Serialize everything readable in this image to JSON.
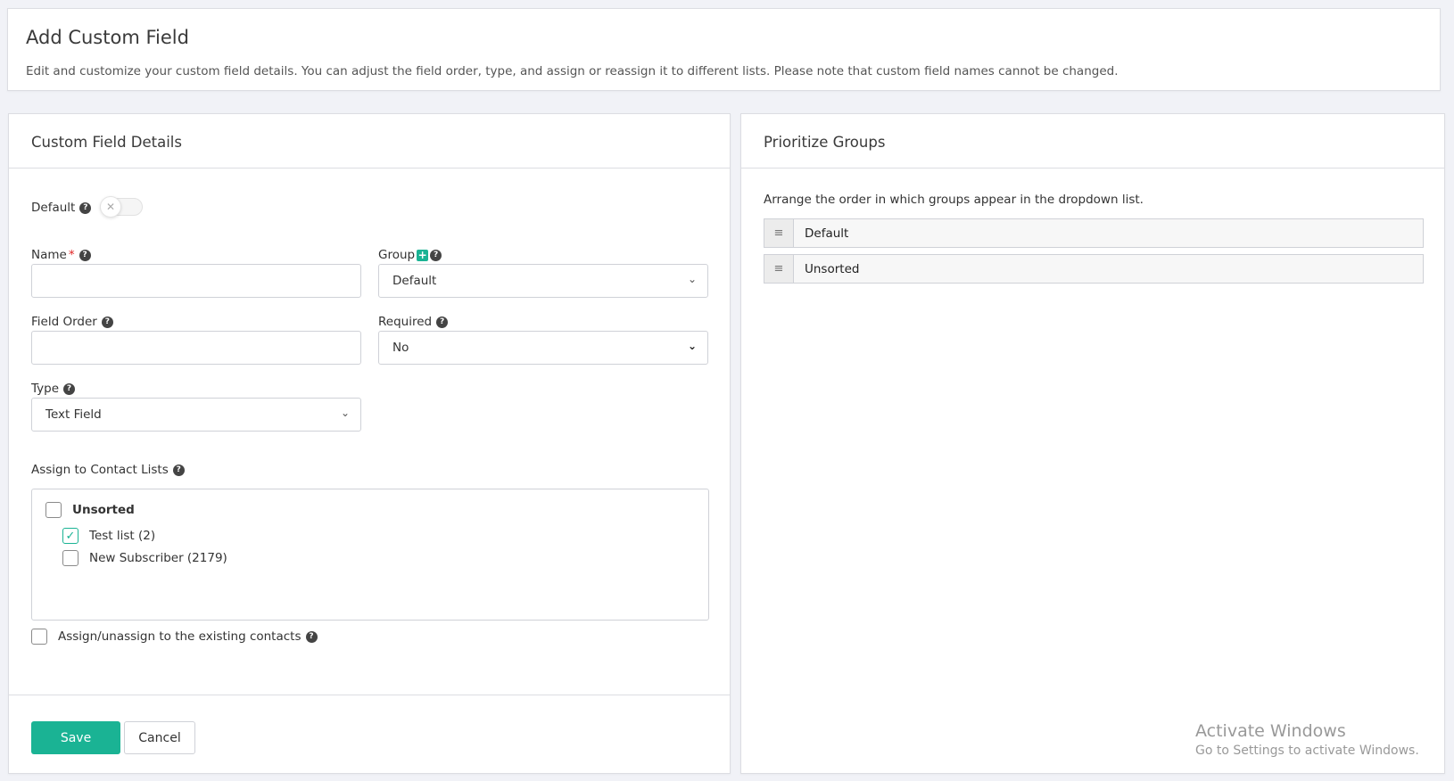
{
  "header": {
    "title": "Add Custom Field",
    "description": "Edit and customize your custom field details. You can adjust the field order, type, and assign or reassign it to different lists. Please note that custom field names cannot be changed."
  },
  "details": {
    "title": "Custom Field Details",
    "default_label": "Default",
    "default_on": false,
    "name_label": "Name",
    "name_required_mark": "*",
    "name_value": "",
    "group_label": "Group",
    "group_value": "Default",
    "field_order_label": "Field Order",
    "field_order_value": "",
    "required_label": "Required",
    "required_value": "No",
    "type_label": "Type",
    "type_value": "Text Field",
    "assign_lists_label": "Assign to Contact Lists",
    "list_group": {
      "label": "Unsorted",
      "checked": false
    },
    "lists": [
      {
        "label": "Test list (2)",
        "checked": true
      },
      {
        "label": "New Subscriber (2179)",
        "checked": false
      }
    ],
    "assign_existing_label": "Assign/unassign to the existing contacts",
    "save_label": "Save",
    "cancel_label": "Cancel"
  },
  "groups": {
    "title": "Prioritize Groups",
    "description": "Arrange the order in which groups appear in the dropdown list.",
    "items": [
      {
        "name": "Default"
      },
      {
        "name": "Unsorted"
      }
    ]
  },
  "watermark": {
    "line1": "Activate Windows",
    "line2": "Go to Settings to activate Windows."
  },
  "colors": {
    "accent": "#1ab394",
    "background": "#f1f2f7",
    "required": "#e02424"
  },
  "icons": {
    "help": "question-circle-icon",
    "add": "plus-square-icon",
    "drag": "drag-handle-icon",
    "check": "check-icon",
    "chevron": "chevron-down-icon",
    "toggle_off": "x-icon"
  }
}
